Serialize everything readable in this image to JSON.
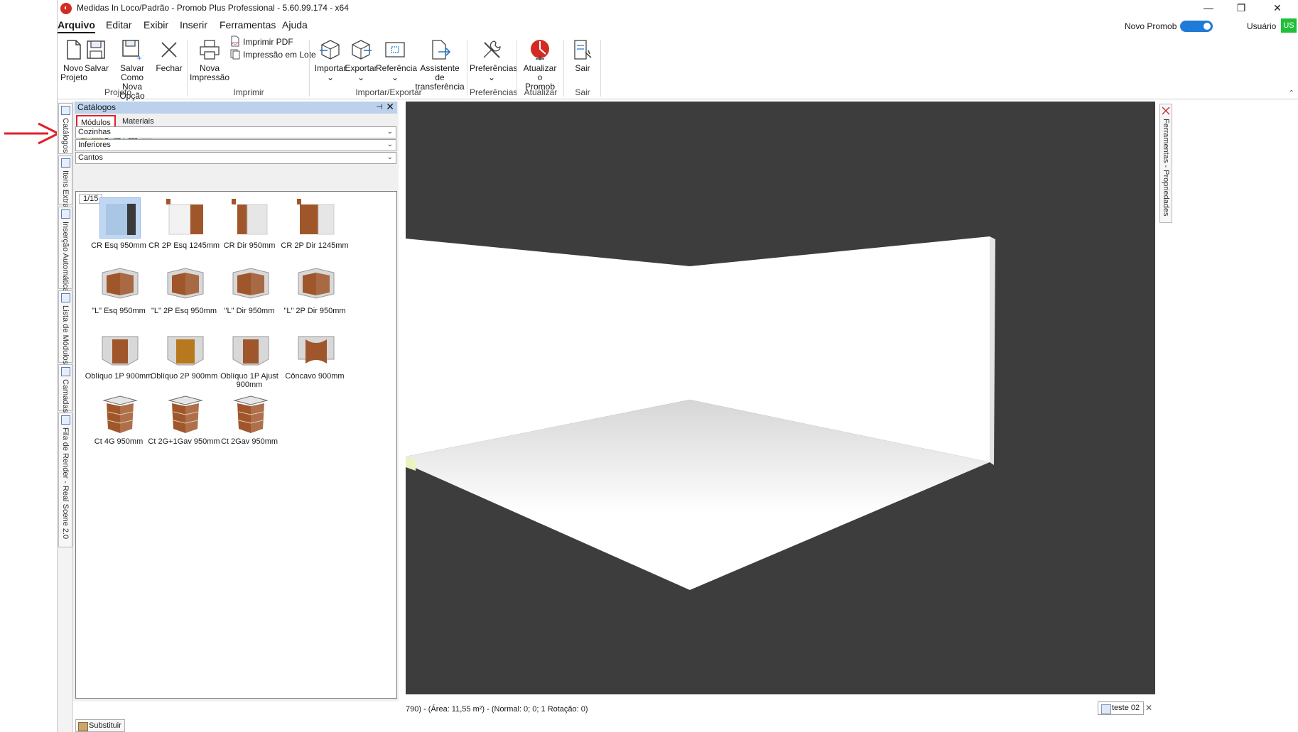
{
  "window": {
    "title": "Medidas In Loco/Padrão - Promob Plus Professional - 5.60.99.174 - x64",
    "minimize": "—",
    "maximize": "❐",
    "close": "✕"
  },
  "menu": {
    "items": [
      "Arquivo",
      "Editar",
      "Exibir",
      "Inserir",
      "Ferramentas",
      "Ajuda"
    ],
    "active": "Arquivo",
    "novo_promob_label": "Novo Promob",
    "novo_promob_on": true,
    "usuario_label": "Usuário",
    "user_initials": "US"
  },
  "ribbon": {
    "novo_projeto": "Novo\nProjeto",
    "salvar": "Salvar",
    "salvar_como": "Salvar Como\nNova Opção",
    "fechar": "Fechar",
    "nova_impressao": "Nova\nImpressão",
    "imprimir_pdf": "Imprimir PDF",
    "impressao_lote": "Impressão em Lote",
    "importar": "Importar",
    "exportar": "Exportar",
    "referencia": "Referência",
    "assistente": "Assistente de\ntransferência",
    "preferencias": "Preferências",
    "atualizar": "Atualizar o\nPromob",
    "sair": "Sair",
    "dropdown_caret": "⌄",
    "groups": {
      "projeto": "Projeto",
      "imprimir": "Imprimir",
      "importar_exportar": "Importar/Exportar",
      "preferencias": "Preferências",
      "atualizar": "Atualizar",
      "sair": "Sair"
    },
    "collapse_glyph": "⌃"
  },
  "left_tabs": [
    {
      "label": "Catálogos",
      "icon": "catalog-icon",
      "active": true
    },
    {
      "label": "Itens Extras",
      "icon": "paperclip-icon",
      "active": false
    },
    {
      "label": "Inserção Automática",
      "icon": "auto-insert-icon",
      "active": false
    },
    {
      "label": "Lista de Módulos",
      "icon": "module-list-icon",
      "active": false
    },
    {
      "label": "Camadas",
      "icon": "layers-icon",
      "active": false
    },
    {
      "label": "Fila de Render - Real Scene 2.0",
      "icon": "render-queue-icon",
      "active": false
    }
  ],
  "catalog": {
    "title": "Catálogos",
    "pin_glyph": "⊣",
    "close_glyph": "✕",
    "tabs": [
      "Módulos",
      "Materiais"
    ],
    "active_tab": "Módulos",
    "dropdowns": [
      "Cozinhas",
      "Inferiores",
      "Cantos"
    ],
    "page_indicator": "1/15",
    "items": [
      {
        "label": "CR Esq 950mm",
        "selected": true,
        "kind": "cr-esq"
      },
      {
        "label": "CR 2P Esq 1245mm",
        "selected": false,
        "kind": "cr-2p-esq"
      },
      {
        "label": "CR Dir 950mm",
        "selected": false,
        "kind": "cr-dir"
      },
      {
        "label": "CR 2P Dir 1245mm",
        "selected": false,
        "kind": "cr-2p-dir"
      },
      {
        "label": "\"L\" Esq 950mm",
        "selected": false,
        "kind": "l"
      },
      {
        "label": "\"L\" 2P Esq 950mm",
        "selected": false,
        "kind": "l"
      },
      {
        "label": "\"L\" Dir 950mm",
        "selected": false,
        "kind": "l"
      },
      {
        "label": "\"L\" 2P Dir 950mm",
        "selected": false,
        "kind": "l"
      },
      {
        "label": "Oblíquo 1P 900mm",
        "selected": false,
        "kind": "obl"
      },
      {
        "label": "Oblíquo 2P 900mm",
        "selected": false,
        "kind": "obl2"
      },
      {
        "label": "Oblíquo 1P Ajust 900mm",
        "selected": false,
        "kind": "obl"
      },
      {
        "label": "Côncavo 900mm",
        "selected": false,
        "kind": "conc"
      },
      {
        "label": "Ct 4G 950mm",
        "selected": false,
        "kind": "ct"
      },
      {
        "label": "Ct 2G+1Gav 950mm",
        "selected": false,
        "kind": "ct"
      },
      {
        "label": "Ct 2Gav 950mm",
        "selected": false,
        "kind": "ct"
      }
    ],
    "substituir": "Substituir"
  },
  "status": {
    "text": "790) - (Área: 11,55 m²) - (Normal: 0; 0; 1 Rotação: 0)",
    "project_tab": "teste 02",
    "project_tab_close": "✕"
  },
  "right_tabs": [
    {
      "label": "Ferramentas - Propriedades",
      "icon": "tools-icon"
    }
  ],
  "colors": {
    "accent": "#1f7ad8",
    "viewport_bg": "#3d3d3d",
    "wood": "#a0562b",
    "highlight_red": "#e0202a",
    "user_badge": "#1fbf3a"
  }
}
